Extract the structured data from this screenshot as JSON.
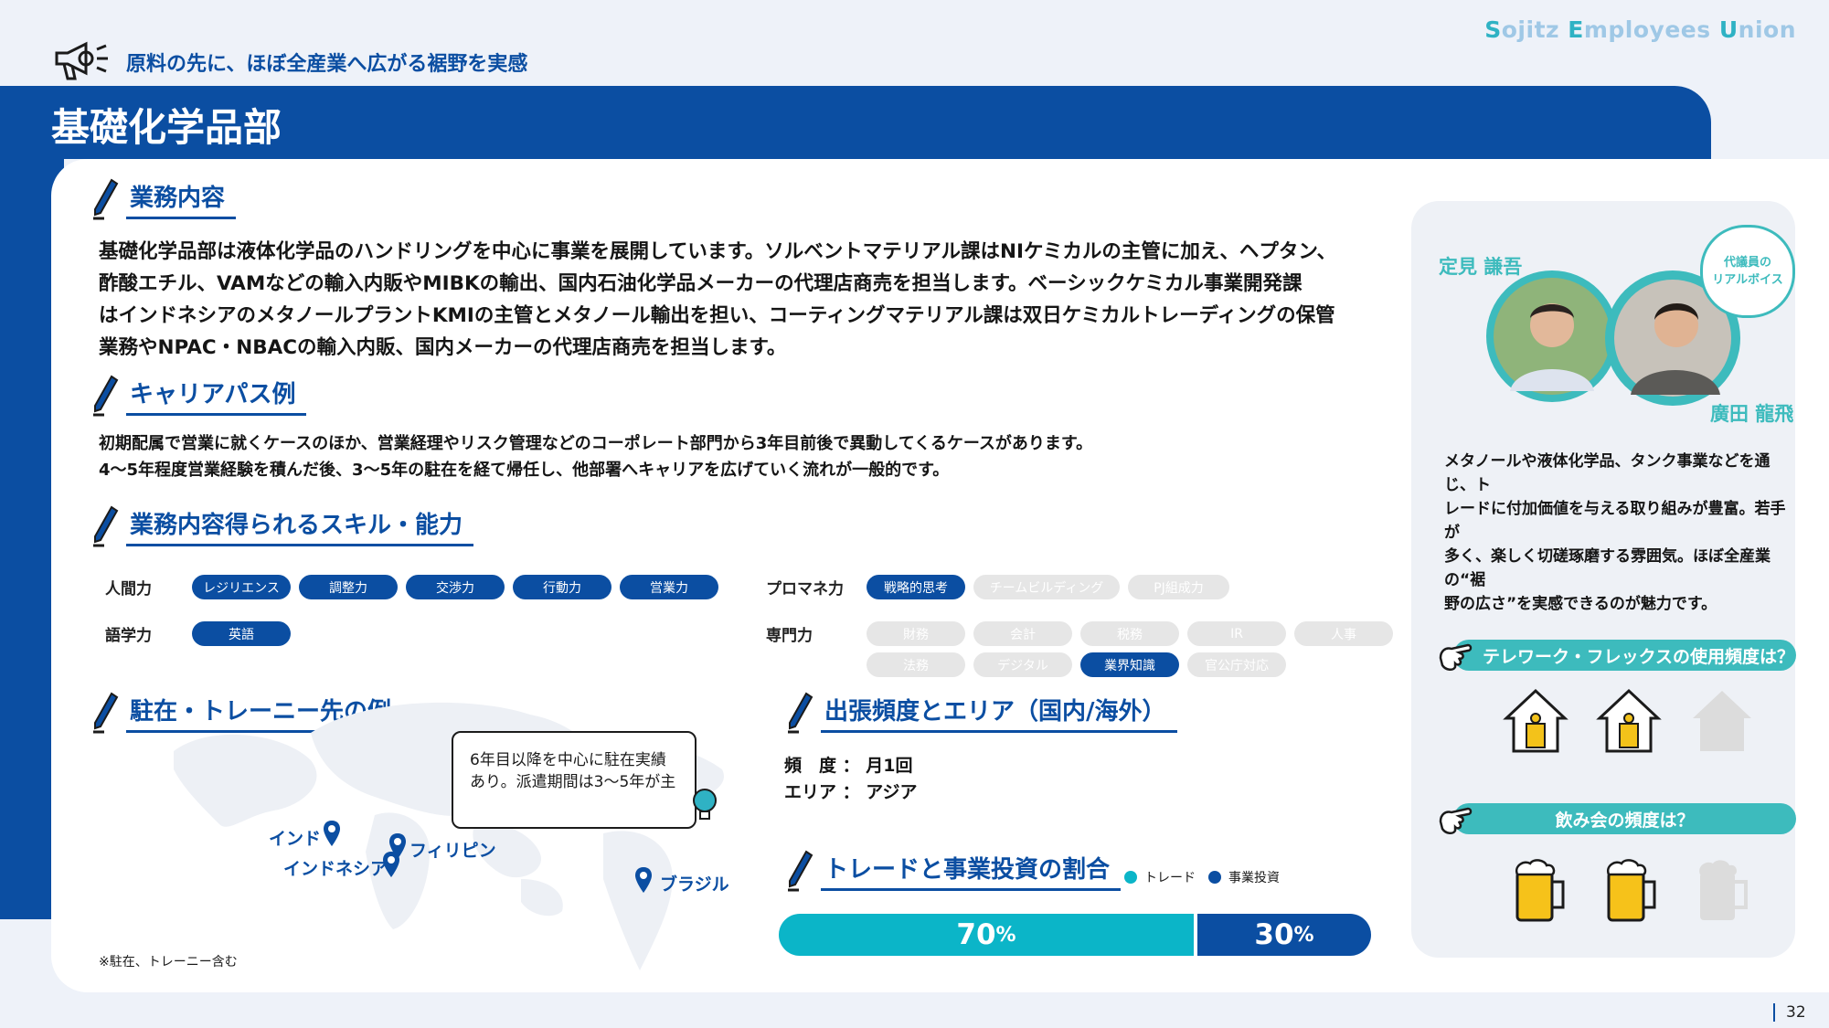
{
  "brand": {
    "s": "S",
    "ojitz": "ojitz ",
    "e": "E",
    "mployees": "mployees ",
    "u": "U",
    "nion": "nion"
  },
  "topline": "原料の先に、ほぼ全産業へ広がる裾野を実感",
  "title": "基礎化学品部",
  "sections": {
    "work": {
      "heading": "業務内容",
      "lines": [
        "基礎化学品部は液体化学品のハンドリングを中心に事業を展開しています。ソルベントマテリアル課はNIケミカルの主管に加え、ヘプタン、",
        "酢酸エチル、VAMなどの輸入内販やMIBKの輸出、国内石油化学品メーカーの代理店商売を担当します。ベーシックケミカル事業開発課",
        "はインドネシアのメタノールプラントKMIの主管とメタノール輸出を担い、コーティングマテリアル課は双日ケミカルトレーディングの保管",
        "業務やNPAC・NBACの輸入内販、国内メーカーの代理店商売を担当します。"
      ]
    },
    "career": {
      "heading": "キャリアパス例",
      "lines": [
        "初期配属で営業に就くケースのほか、営業経理やリスク管理などのコーポレート部門から3年目前後で異動してくるケースがあります。",
        "4～5年程度営業経験を積んだ後、3～5年の駐在を経て帰任し、他部署へキャリアを広げていく流れが一般的です。"
      ]
    },
    "skills": {
      "heading": "業務内容得られるスキル・能力",
      "groups": [
        {
          "label": "人間力",
          "items": [
            {
              "t": "レジリエンス",
              "on": true
            },
            {
              "t": "調整力",
              "on": true
            },
            {
              "t": "交渉力",
              "on": true
            },
            {
              "t": "行動力",
              "on": true
            },
            {
              "t": "営業力",
              "on": true
            }
          ]
        },
        {
          "label": "語学力",
          "items": [
            {
              "t": "英語",
              "on": true
            }
          ]
        },
        {
          "label": "プロマネ力",
          "items": [
            {
              "t": "戦略的思考",
              "on": true
            },
            {
              "t": "チームビルディング",
              "on": false
            },
            {
              "t": "PJ組成力",
              "on": false
            }
          ]
        },
        {
          "label": "専門力",
          "items": [
            {
              "t": "財務",
              "on": false
            },
            {
              "t": "会計",
              "on": false
            },
            {
              "t": "税務",
              "on": false
            },
            {
              "t": "IR",
              "on": false
            },
            {
              "t": "人事",
              "on": false
            },
            {
              "t": "法務",
              "on": false
            },
            {
              "t": "デジタル",
              "on": false
            },
            {
              "t": "業界知識",
              "on": true
            },
            {
              "t": "官公庁対応",
              "on": false
            }
          ]
        }
      ]
    },
    "posting": {
      "heading": "駐在・トレーニー先の例",
      "bubble": [
        "6年目以降を中心に駐在実績",
        "あり。派遣期間は3～5年が主"
      ],
      "places": {
        "india": "インド",
        "philippines": "フィリピン",
        "indonesia": "インドネシア",
        "brazil": "ブラジル"
      },
      "note": "※駐在、トレーニー含む"
    },
    "trip": {
      "heading": "出張頻度とエリア（国内/海外）",
      "freq_label": "頻　度",
      "freq_value": "月1回",
      "area_label": "エリア",
      "area_value": "アジア",
      "sep": "："
    },
    "ratio": {
      "heading": "トレードと事業投資の割合",
      "legend_trade": "トレード",
      "legend_invest": "事業投資",
      "trade_num": "70",
      "invest_num": "30",
      "pct": "%",
      "trade_value": 0.7,
      "invest_value": 0.3
    }
  },
  "side": {
    "name1": "定見 謙吾",
    "name2": "廣田 龍飛",
    "badge": [
      "代議員の",
      "リアルボイス"
    ],
    "text": [
      "メタノールや液体化学品、タンク事業などを通じ、ト",
      "レードに付加価値を与える取り組みが豊富。若手が",
      "多く、楽しく切磋琢磨する雰囲気。ほぼ全産業の“裾",
      "野の広さ”を実感できるのが魅力です。"
    ],
    "q1": "テレワーク・フレックスの使用頻度は？",
    "q1_level": 2,
    "q1_max": 3,
    "q2": "飲み会の頻度は？",
    "q2_level": 2,
    "q2_max": 3
  },
  "colors": {
    "navy": "#0b4ea2",
    "teal": "#3dbbbd",
    "cyan": "#0bb5c8"
  },
  "page": "32"
}
